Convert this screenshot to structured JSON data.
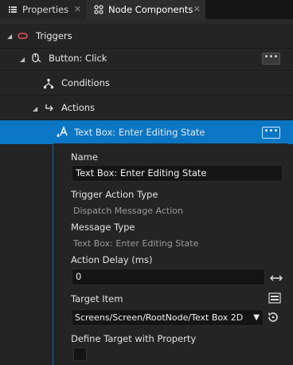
{
  "tabs": [
    {
      "label": "Properties",
      "icon": "properties-icon",
      "close": "✕"
    },
    {
      "label": "Node Components",
      "icon": "node-components-icon",
      "close": "✕"
    }
  ],
  "tree": {
    "triggers": {
      "label": "Triggers",
      "icon": "triggers-icon"
    },
    "button_click": {
      "label": "Button: Click",
      "icon": "mouse-click-icon",
      "more": "•••"
    },
    "conditions": {
      "label": "Conditions",
      "icon": "conditions-icon"
    },
    "actions": {
      "label": "Actions",
      "icon": "actions-icon"
    },
    "textbox_action": {
      "label": "Text Box: Enter Editing State",
      "icon": "text-action-icon",
      "more": "•••"
    }
  },
  "properties": {
    "name_label": "Name",
    "name_value": "Text Box: Enter Editing State",
    "trigger_action_type_label": "Trigger Action Type",
    "trigger_action_type_value": "Dispatch Message Action",
    "message_type_label": "Message Type",
    "message_type_value": "Text Box: Enter Editing State",
    "action_delay_label": "Action Delay (ms)",
    "action_delay_value": "0",
    "target_item_label": "Target Item",
    "target_item_value": "Screens/Screen/RootNode/Text Box 2D",
    "define_target_label": "Define Target with Property",
    "define_target_checked": false
  },
  "colors": {
    "selection": "#0b77c4",
    "panel": "#242424",
    "input": "#141414"
  }
}
